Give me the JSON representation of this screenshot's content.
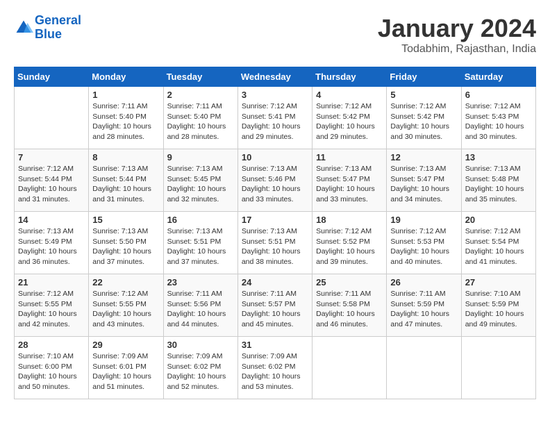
{
  "logo": {
    "line1": "General",
    "line2": "Blue"
  },
  "title": "January 2024",
  "location": "Todabhim, Rajasthan, India",
  "columns": [
    "Sunday",
    "Monday",
    "Tuesday",
    "Wednesday",
    "Thursday",
    "Friday",
    "Saturday"
  ],
  "weeks": [
    [
      {
        "day": "",
        "sunrise": "",
        "sunset": "",
        "daylight": ""
      },
      {
        "day": "1",
        "sunrise": "Sunrise: 7:11 AM",
        "sunset": "Sunset: 5:40 PM",
        "daylight": "Daylight: 10 hours and 28 minutes."
      },
      {
        "day": "2",
        "sunrise": "Sunrise: 7:11 AM",
        "sunset": "Sunset: 5:40 PM",
        "daylight": "Daylight: 10 hours and 28 minutes."
      },
      {
        "day": "3",
        "sunrise": "Sunrise: 7:12 AM",
        "sunset": "Sunset: 5:41 PM",
        "daylight": "Daylight: 10 hours and 29 minutes."
      },
      {
        "day": "4",
        "sunrise": "Sunrise: 7:12 AM",
        "sunset": "Sunset: 5:42 PM",
        "daylight": "Daylight: 10 hours and 29 minutes."
      },
      {
        "day": "5",
        "sunrise": "Sunrise: 7:12 AM",
        "sunset": "Sunset: 5:42 PM",
        "daylight": "Daylight: 10 hours and 30 minutes."
      },
      {
        "day": "6",
        "sunrise": "Sunrise: 7:12 AM",
        "sunset": "Sunset: 5:43 PM",
        "daylight": "Daylight: 10 hours and 30 minutes."
      }
    ],
    [
      {
        "day": "7",
        "sunrise": "Sunrise: 7:12 AM",
        "sunset": "Sunset: 5:44 PM",
        "daylight": "Daylight: 10 hours and 31 minutes."
      },
      {
        "day": "8",
        "sunrise": "Sunrise: 7:13 AM",
        "sunset": "Sunset: 5:44 PM",
        "daylight": "Daylight: 10 hours and 31 minutes."
      },
      {
        "day": "9",
        "sunrise": "Sunrise: 7:13 AM",
        "sunset": "Sunset: 5:45 PM",
        "daylight": "Daylight: 10 hours and 32 minutes."
      },
      {
        "day": "10",
        "sunrise": "Sunrise: 7:13 AM",
        "sunset": "Sunset: 5:46 PM",
        "daylight": "Daylight: 10 hours and 33 minutes."
      },
      {
        "day": "11",
        "sunrise": "Sunrise: 7:13 AM",
        "sunset": "Sunset: 5:47 PM",
        "daylight": "Daylight: 10 hours and 33 minutes."
      },
      {
        "day": "12",
        "sunrise": "Sunrise: 7:13 AM",
        "sunset": "Sunset: 5:47 PM",
        "daylight": "Daylight: 10 hours and 34 minutes."
      },
      {
        "day": "13",
        "sunrise": "Sunrise: 7:13 AM",
        "sunset": "Sunset: 5:48 PM",
        "daylight": "Daylight: 10 hours and 35 minutes."
      }
    ],
    [
      {
        "day": "14",
        "sunrise": "Sunrise: 7:13 AM",
        "sunset": "Sunset: 5:49 PM",
        "daylight": "Daylight: 10 hours and 36 minutes."
      },
      {
        "day": "15",
        "sunrise": "Sunrise: 7:13 AM",
        "sunset": "Sunset: 5:50 PM",
        "daylight": "Daylight: 10 hours and 37 minutes."
      },
      {
        "day": "16",
        "sunrise": "Sunrise: 7:13 AM",
        "sunset": "Sunset: 5:51 PM",
        "daylight": "Daylight: 10 hours and 37 minutes."
      },
      {
        "day": "17",
        "sunrise": "Sunrise: 7:13 AM",
        "sunset": "Sunset: 5:51 PM",
        "daylight": "Daylight: 10 hours and 38 minutes."
      },
      {
        "day": "18",
        "sunrise": "Sunrise: 7:12 AM",
        "sunset": "Sunset: 5:52 PM",
        "daylight": "Daylight: 10 hours and 39 minutes."
      },
      {
        "day": "19",
        "sunrise": "Sunrise: 7:12 AM",
        "sunset": "Sunset: 5:53 PM",
        "daylight": "Daylight: 10 hours and 40 minutes."
      },
      {
        "day": "20",
        "sunrise": "Sunrise: 7:12 AM",
        "sunset": "Sunset: 5:54 PM",
        "daylight": "Daylight: 10 hours and 41 minutes."
      }
    ],
    [
      {
        "day": "21",
        "sunrise": "Sunrise: 7:12 AM",
        "sunset": "Sunset: 5:55 PM",
        "daylight": "Daylight: 10 hours and 42 minutes."
      },
      {
        "day": "22",
        "sunrise": "Sunrise: 7:12 AM",
        "sunset": "Sunset: 5:55 PM",
        "daylight": "Daylight: 10 hours and 43 minutes."
      },
      {
        "day": "23",
        "sunrise": "Sunrise: 7:11 AM",
        "sunset": "Sunset: 5:56 PM",
        "daylight": "Daylight: 10 hours and 44 minutes."
      },
      {
        "day": "24",
        "sunrise": "Sunrise: 7:11 AM",
        "sunset": "Sunset: 5:57 PM",
        "daylight": "Daylight: 10 hours and 45 minutes."
      },
      {
        "day": "25",
        "sunrise": "Sunrise: 7:11 AM",
        "sunset": "Sunset: 5:58 PM",
        "daylight": "Daylight: 10 hours and 46 minutes."
      },
      {
        "day": "26",
        "sunrise": "Sunrise: 7:11 AM",
        "sunset": "Sunset: 5:59 PM",
        "daylight": "Daylight: 10 hours and 47 minutes."
      },
      {
        "day": "27",
        "sunrise": "Sunrise: 7:10 AM",
        "sunset": "Sunset: 5:59 PM",
        "daylight": "Daylight: 10 hours and 49 minutes."
      }
    ],
    [
      {
        "day": "28",
        "sunrise": "Sunrise: 7:10 AM",
        "sunset": "Sunset: 6:00 PM",
        "daylight": "Daylight: 10 hours and 50 minutes."
      },
      {
        "day": "29",
        "sunrise": "Sunrise: 7:09 AM",
        "sunset": "Sunset: 6:01 PM",
        "daylight": "Daylight: 10 hours and 51 minutes."
      },
      {
        "day": "30",
        "sunrise": "Sunrise: 7:09 AM",
        "sunset": "Sunset: 6:02 PM",
        "daylight": "Daylight: 10 hours and 52 minutes."
      },
      {
        "day": "31",
        "sunrise": "Sunrise: 7:09 AM",
        "sunset": "Sunset: 6:02 PM",
        "daylight": "Daylight: 10 hours and 53 minutes."
      },
      {
        "day": "",
        "sunrise": "",
        "sunset": "",
        "daylight": ""
      },
      {
        "day": "",
        "sunrise": "",
        "sunset": "",
        "daylight": ""
      },
      {
        "day": "",
        "sunrise": "",
        "sunset": "",
        "daylight": ""
      }
    ]
  ]
}
